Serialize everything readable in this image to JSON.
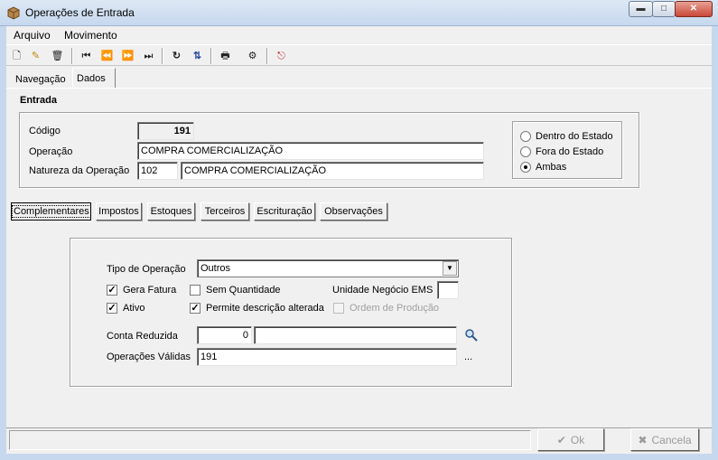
{
  "window": {
    "title": "Operações de Entrada",
    "min_glyph": "▬",
    "max_glyph": "□",
    "close_glyph": "✕"
  },
  "menu": {
    "items": [
      "Arquivo",
      "Movimento"
    ]
  },
  "toolbar": {
    "icons": [
      "new-icon",
      "edit-icon",
      "delete-icon",
      "first-record-icon",
      "previous-record-icon",
      "next-record-icon",
      "last-record-icon",
      "refresh-icon",
      "sort-icon",
      "print-icon",
      "properties-icon",
      "exit-icon"
    ],
    "glyphs": [
      "🗋",
      "✎",
      "🗑",
      "⏮",
      "⏪",
      "⏩",
      "⏭",
      "↻",
      "⇅",
      "🖶",
      "⚙",
      "⎋"
    ]
  },
  "tabs_top": [
    "Navegação",
    "Dados"
  ],
  "entrada": {
    "title": "Entrada",
    "codigo_label": "Código",
    "codigo": "191",
    "operacao_label": "Operação",
    "operacao": "COMPRA COMERCIALIZAÇÃO",
    "natureza_label": "Natureza da Operação",
    "natureza_code": "102",
    "natureza_desc": "COMPRA COMERCIALIZAÇÃO",
    "radios": [
      "Dentro do Estado",
      "Fora do Estado",
      "Ambas"
    ],
    "radio_selected": "Ambas"
  },
  "subtabs": [
    "Complementares",
    "Impostos",
    "Estoques",
    "Terceiros",
    "Escrituração",
    "Observações"
  ],
  "complementares": {
    "tipo_operacao_label": "Tipo de Operação",
    "tipo_operacao": "Outros",
    "gera_fatura": "Gera Fatura",
    "sem_quantidade": "Sem Quantidade",
    "unidade_negocio": "Unidade Negócio EMS",
    "unidade_negocio_value": "",
    "ativo": "Ativo",
    "permite_descricao": "Permite descrição alterada",
    "ordem_producao": "Ordem de Produção",
    "conta_reduzida_label": "Conta Reduzida",
    "conta_reduzida": "0",
    "conta_desc": "",
    "operacoes_validas_label": "Operações Válidas",
    "operacoes_validas": "191",
    "ellipsis": "..."
  },
  "buttons": {
    "ok": "Ok",
    "cancel": "Cancela",
    "ok_glyph": "✔",
    "cancel_glyph": "✖"
  }
}
